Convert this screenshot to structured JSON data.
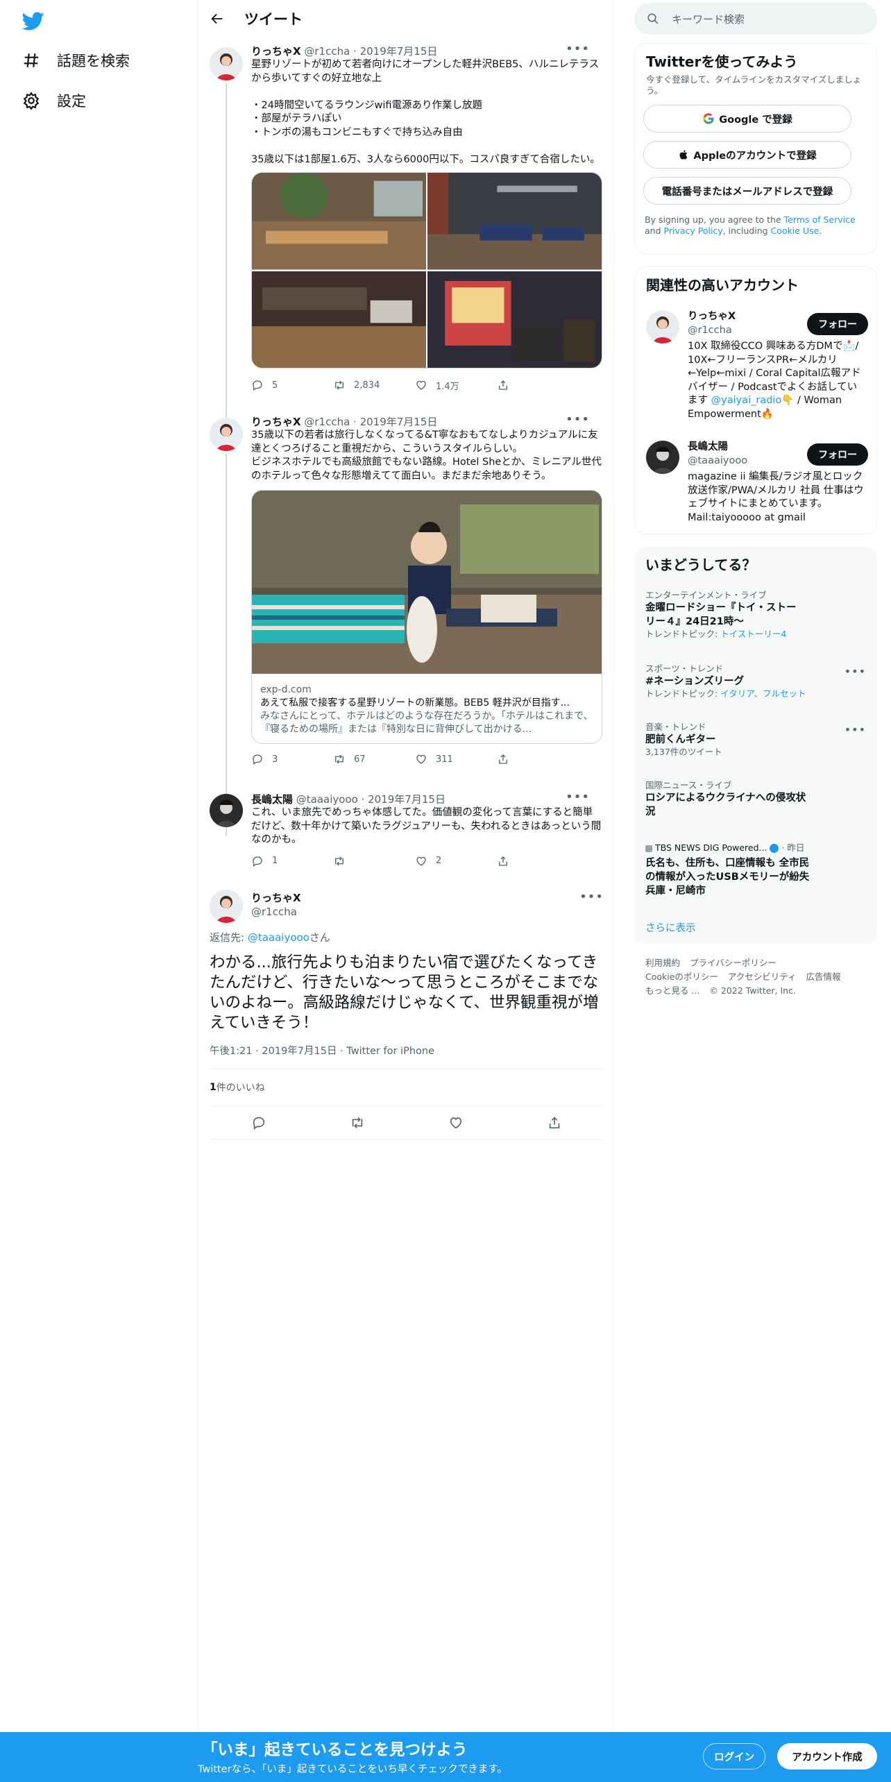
{
  "nav": {
    "explore_label": "話題を検索",
    "settings_label": "設定"
  },
  "header": {
    "title": "ツイート"
  },
  "tweets": [
    {
      "name": "りっちゃX",
      "meta": "@r1ccha · 2019年7月15日",
      "text": "星野リゾートが初めて若者向けにオープンした軽井沢BEB5、ハルニレテラスから歩いてすぐの好立地な上\n\n・24時間空いてるラウンジwifi電源あり作業し放題\n・部屋がテラハぽい\n・トンボの湯もコンビニもすぐで持ち込み自由\n\n35歳以下は1部屋1.6万、3人なら6000円以下。コスパ良すぎて合宿したい。",
      "replies": "5",
      "retweets": "2,834",
      "likes": "1.4万"
    },
    {
      "name": "りっちゃX",
      "meta": "@r1ccha · 2019年7月15日",
      "text": "35歳以下の若者は旅行しなくなってる&T寧なおもてなしよりカジュアルに友達とくつろげること重視だから、こういうスタイルらしい。\nビジネスホテルでも高級旅館でもない路線。Hotel Sheとか、ミレニアル世代のホテルって色々な形態増えてて面白い。まだまだ余地ありそう。",
      "card_domain": "exp-d.com",
      "card_title": "あえて私服で接客する星野リゾートの新業態。BEB5 軽井沢が目指す...",
      "card_desc": "みなさんにとって、ホテルはどのような存在だろうか。「ホテルはこれまで、『寝るための場所』または『特別な日に背伸びして出かける...",
      "replies": "3",
      "retweets": "67",
      "likes": "311"
    },
    {
      "name": "長嶋太陽",
      "meta": "@taaaiyooo · 2019年7月15日",
      "text": "これ、いま旅先でめっちゃ体感してた。価値観の変化って言葉にすると簡単だけど、数十年かけて築いたラグジュアリーも、失われるときはあっという間なのかも。",
      "replies": "1",
      "retweets": "",
      "likes": "2"
    }
  ],
  "focus": {
    "name": "りっちゃX",
    "handle": "@r1ccha",
    "reply_prefix": "返信先: ",
    "reply_handle": "@taaaiyooo",
    "reply_suffix": "さん",
    "text": "わかる...旅行先よりも泊まりたい宿で選びたくなってきたんだけど、行きたいな〜って思うところがそこまでないのよねー。高級路線だけじゃなくて、世界観重視が増えていきそう！",
    "timestamp": "午後1:21 · 2019年7月15日 · Twitter for iPhone",
    "like_count": "1",
    "like_label": " 件のいいね"
  },
  "search": {
    "placeholder": "キーワード検索"
  },
  "signup_box": {
    "title": "Twitterを使ってみよう",
    "subtitle": "今すぐ登録して、タイムラインをカスタマイズしましょう。",
    "google": "Google で登録",
    "apple": "Appleのアカウントで登録",
    "phone": "電話番号またはメールアドレスで登録",
    "terms_1": "By signing up, you agree to the ",
    "terms_link": "Terms of Service",
    "terms_2": " and ",
    "privacy_link": "Privacy Policy",
    "terms_3": ", including ",
    "cookie_link": "Cookie Use",
    "terms_4": "."
  },
  "related": {
    "title": "関連性の高いアカウント",
    "follow_label": "フォロー",
    "accounts": [
      {
        "name": "りっちゃX",
        "handle": "@r1ccha",
        "bio_1": "10X 取締役CCO 興味ある方DMで📩/ 10X←フリーランスPR←メルカリ←Yelp←mixi / Coral Capital広報アドバイザー / Podcastでよくお話しています ",
        "bio_link": "@yaiyai_radio",
        "bio_2": "👇 / Woman Empowerment🔥"
      },
      {
        "name": "長嶋太陽",
        "handle": "@taaaiyooo",
        "bio_1": "magazine ii 編集長/ラジオ風とロック 放送作家/PWA/メルカリ 社員 仕事はウェブサイトにまとめています。Mail:taiyooooo at gmail",
        "bio_link": "",
        "bio_2": ""
      }
    ]
  },
  "trends": {
    "title": "いまどうしてる？",
    "items": [
      {
        "cat": "エンターテインメント・ライブ",
        "title": "金曜ロードショー『トイ・ストーリー４』24日21時〜",
        "sub_prefix": "トレンドトピック: ",
        "sub_link": "トイストーリー4"
      },
      {
        "cat": "スポーツ・トレンド",
        "title": "#ネーションズリーグ",
        "sub_prefix": "トレンドトピック: ",
        "sub_link": "イタリア、フルセット"
      },
      {
        "cat": "音楽・トレンド",
        "title": "肥前くんギター",
        "sub_prefix": "3,137件のツイート",
        "sub_link": ""
      },
      {
        "cat": "国際ニュース・ライブ",
        "title": "ロシアによるウクライナへの侵攻状況",
        "sub_prefix": "",
        "sub_link": ""
      },
      {
        "cat": "TBS NEWS DIG Powered... ",
        "cat_time": " · 昨日",
        "title": "氏名も、住所も、口座情報も 全市民の情報が入ったUSBメモリーが紛失　兵庫・尼崎市",
        "sub_prefix": "",
        "sub_link": ""
      }
    ],
    "show_more": "さらに表示"
  },
  "footer": {
    "links": [
      "利用規約",
      "プライバシーポリシー",
      "Cookieのポリシー",
      "アクセシビリティ",
      "広告情報",
      "もっと見る ..."
    ],
    "copyright": "© 2022 Twitter, Inc."
  },
  "bottombar": {
    "title": "「いま」起きていることを見つけよう",
    "subtitle": "Twitterなら、「いま」起きていることをいち早くチェックできます。",
    "login": "ログイン",
    "signup": "アカウント作成"
  },
  "colors": {
    "accent": "#1d9bf0",
    "text": "#0f1419",
    "muted": "#536471"
  }
}
